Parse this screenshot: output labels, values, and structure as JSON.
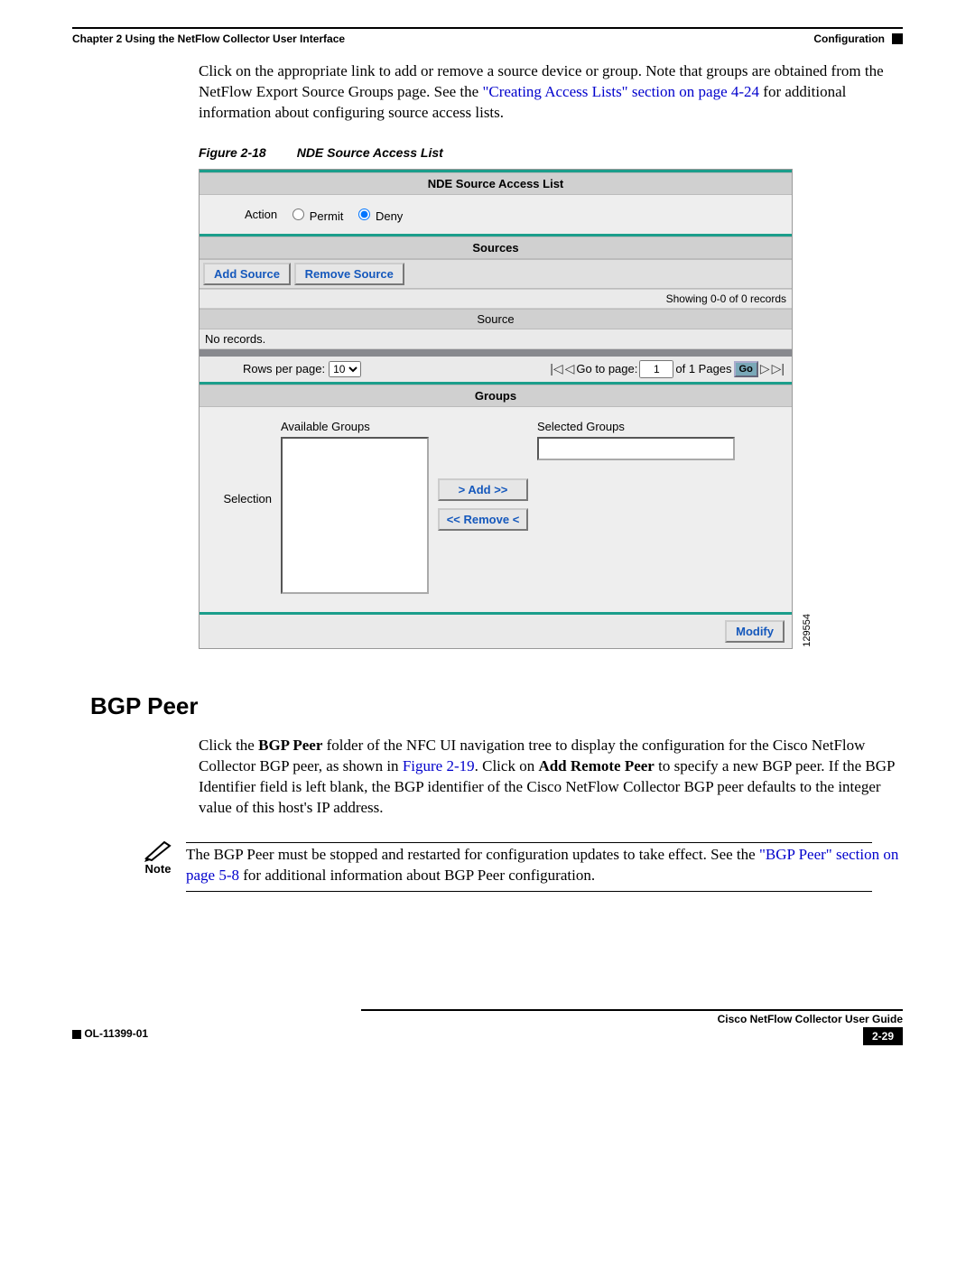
{
  "header": {
    "chapter": "Chapter 2      Using the NetFlow Collector User Interface",
    "section": "Configuration"
  },
  "intro": {
    "pre": "Click on the appropriate link to add or remove a source device or group. Note that groups are obtained from the NetFlow Export Source Groups page. See the ",
    "link": "\"Creating Access Lists\" section on page 4-24",
    "post": " for additional information about configuring source access lists."
  },
  "figure_caption": {
    "num": "Figure 2-18",
    "title": "NDE Source Access List"
  },
  "figure": {
    "title_bar": "NDE Source Access List",
    "action_label": "Action",
    "permit": "Permit",
    "deny": "Deny",
    "sources_header": "Sources",
    "add_source": "Add Source",
    "remove_source": "Remove Source",
    "showing": "Showing 0-0 of 0 records",
    "source_col": "Source",
    "no_records": "No records.",
    "rows_per_page_label": "Rows per page:",
    "rows_per_page_value": "10",
    "goto_label": "Go to page:",
    "goto_value": "1",
    "of_pages": "of 1 Pages",
    "go": "Go",
    "groups_header": "Groups",
    "selection_label": "Selection",
    "available_groups": "Available Groups",
    "selected_groups": "Selected Groups",
    "add_btn": ">    Add    >>",
    "remove_btn": "<< Remove <",
    "modify": "Modify",
    "sidenum": "129554"
  },
  "heading": "BGP Peer",
  "bgp_para": {
    "t1": "Click the ",
    "b1": "BGP Peer",
    "t2": " folder of the NFC UI navigation tree to display the configuration for the Cisco NetFlow Collector BGP peer, as shown in ",
    "link1": "Figure 2-19",
    "t3": ". Click on ",
    "b2": "Add Remote Peer",
    "t4": " to specify a new BGP peer. If the BGP Identifier field is left blank, the BGP identifier of the Cisco NetFlow Collector BGP peer defaults to the integer value of this host's IP address."
  },
  "note": {
    "label": "Note",
    "t1": "The BGP Peer must be stopped and restarted for configuration updates to take effect. See the ",
    "link": "\"BGP Peer\" section on page 5-8",
    "t2": " for additional information about BGP Peer configuration."
  },
  "footer": {
    "title": "Cisco NetFlow Collector User Guide",
    "doc": "OL-11399-01",
    "page": "2-29"
  }
}
